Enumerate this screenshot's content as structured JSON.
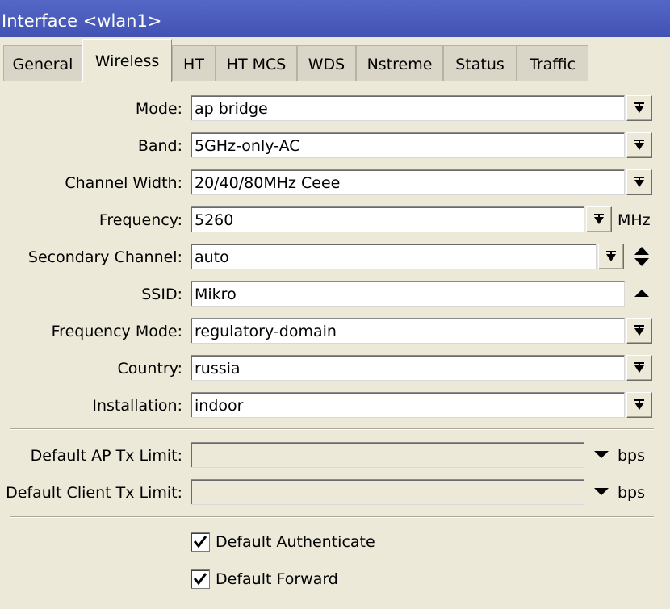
{
  "window": {
    "title": "Interface <wlan1>"
  },
  "tabs": [
    "General",
    "Wireless",
    "HT",
    "HT MCS",
    "WDS",
    "Nstreme",
    "Status",
    "Traffic"
  ],
  "active_tab": "Wireless",
  "form": {
    "mode": {
      "label": "Mode:",
      "value": "ap bridge"
    },
    "band": {
      "label": "Band:",
      "value": "5GHz-only-AC"
    },
    "channel_width": {
      "label": "Channel Width:",
      "value": "20/40/80MHz Ceee"
    },
    "frequency": {
      "label": "Frequency:",
      "value": "5260",
      "unit": "MHz"
    },
    "secondary_channel": {
      "label": "Secondary Channel:",
      "value": "auto"
    },
    "ssid": {
      "label": "SSID:",
      "value": "Mikro"
    },
    "frequency_mode": {
      "label": "Frequency Mode:",
      "value": "regulatory-domain"
    },
    "country": {
      "label": "Country:",
      "value": "russia"
    },
    "installation": {
      "label": "Installation:",
      "value": "indoor"
    },
    "default_ap_tx_limit": {
      "label": "Default AP Tx Limit:",
      "value": "",
      "unit": "bps"
    },
    "default_client_tx_limit": {
      "label": "Default Client Tx Limit:",
      "value": "",
      "unit": "bps"
    },
    "default_authenticate": {
      "label": "Default Authenticate",
      "checked": true
    },
    "default_forward": {
      "label": "Default Forward",
      "checked": true
    }
  },
  "icons": {
    "dropdown": "dropdown-arrow-icon",
    "updown": "up-down-arrows-icon",
    "collapse": "triangle-up-icon",
    "expand": "triangle-down-icon",
    "check": "checkmark-icon"
  }
}
